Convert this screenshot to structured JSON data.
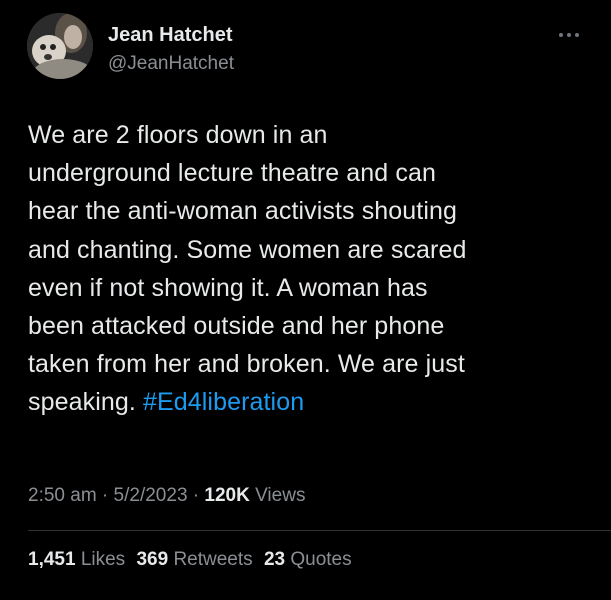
{
  "author": {
    "display_name": "Jean Hatchet",
    "handle": "@JeanHatchet",
    "avatar_icon": "profile-photo-with-dog"
  },
  "more_icon": "ellipsis-icon",
  "tweet": {
    "lines": [
      "We are 2 floors down in an",
      "underground lecture theatre and can",
      "hear the anti-woman activists shouting",
      "and chanting. Some women are scared",
      "even if not showing it. A woman has",
      "been attacked outside and her phone",
      "taken from her and broken. We are just",
      "speaking. "
    ],
    "hashtag": "#Ed4liberation"
  },
  "meta": {
    "time": "2:50 am",
    "sep1": " · ",
    "date": "5/2/2023",
    "sep2": " · ",
    "views_count": "120K",
    "views_label": " Views"
  },
  "stats": {
    "likes_count": "1,451",
    "likes_label": "Likes",
    "retweets_count": "369",
    "retweets_label": "Retweets",
    "quotes_count": "23",
    "quotes_label": "Quotes"
  },
  "colors": {
    "background": "#000000",
    "text": "#e7e9ea",
    "secondary": "#8b8f94",
    "link": "#1d9bf0"
  }
}
